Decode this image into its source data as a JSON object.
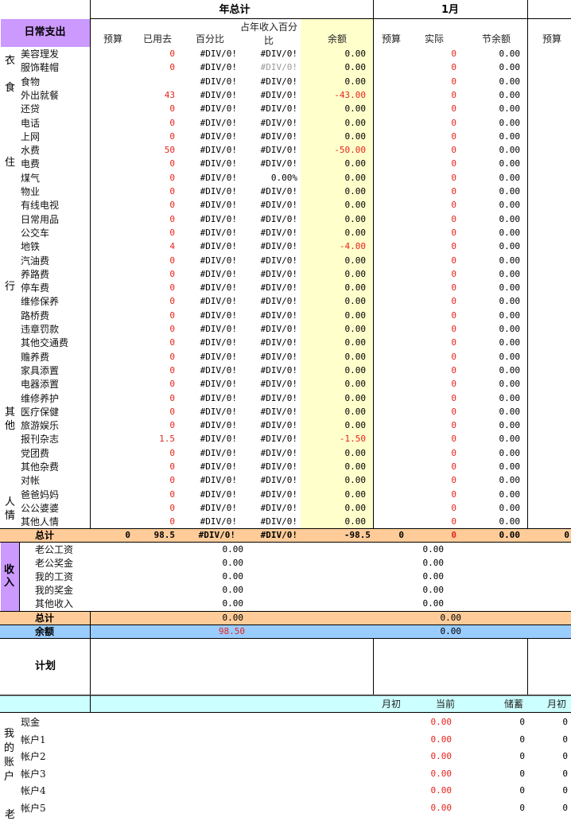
{
  "colors": {
    "header_purple": "#cc99ff",
    "yellow_col": "#ffffcc",
    "total_orange": "#ffcc99",
    "balance_blue": "#99ccff",
    "cyan_row": "#ccffff",
    "red_text": "#e8231b"
  },
  "top": {
    "year_total": "年总计",
    "month": "1月"
  },
  "daily": {
    "title": "日常支出",
    "headers": {
      "budget": "预算",
      "used": "已用去",
      "percent": "百分比",
      "income_pct": "占年收入百分比",
      "balance": "余额",
      "m_budget": "预算",
      "m_actual": "实际",
      "m_saved": "节余额",
      "n_budget": "预算"
    },
    "categories": [
      "衣",
      "食",
      "住",
      "行",
      "其他",
      "人情"
    ],
    "rows": [
      {
        "name": "美容理发",
        "used": "0",
        "pct": "#DIV/0!",
        "inc": "#DIV/0!",
        "bal": "0.00",
        "act": "0",
        "save": "0.00"
      },
      {
        "name": "服饰鞋帽",
        "used": "0",
        "pct": "#DIV/0!",
        "inc": "#DIV/0!",
        "bal": "0.00",
        "act": "0",
        "save": "0.00"
      },
      {
        "name": "食物",
        "used": "",
        "pct": "#DIV/0!",
        "inc": "#DIV/0!",
        "bal": "0.00",
        "act": "0",
        "save": "0.00"
      },
      {
        "name": "外出就餐",
        "used": "43",
        "pct": "#DIV/0!",
        "inc": "#DIV/0!",
        "bal": "-43.00",
        "act": "0",
        "save": "0.00"
      },
      {
        "name": "还贷",
        "used": "0",
        "pct": "#DIV/0!",
        "inc": "#DIV/0!",
        "bal": "0.00",
        "act": "0",
        "save": "0.00"
      },
      {
        "name": "电话",
        "used": "0",
        "pct": "#DIV/0!",
        "inc": "#DIV/0!",
        "bal": "0.00",
        "act": "0",
        "save": "0.00"
      },
      {
        "name": "上网",
        "used": "0",
        "pct": "#DIV/0!",
        "inc": "#DIV/0!",
        "bal": "0.00",
        "act": "0",
        "save": "0.00"
      },
      {
        "name": "水费",
        "used": "50",
        "pct": "#DIV/0!",
        "inc": "#DIV/0!",
        "bal": "-50.00",
        "act": "0",
        "save": "0.00"
      },
      {
        "name": "电费",
        "used": "0",
        "pct": "#DIV/0!",
        "inc": "#DIV/0!",
        "bal": "0.00",
        "act": "0",
        "save": "0.00"
      },
      {
        "name": "煤气",
        "used": "0",
        "pct": "#DIV/0!",
        "inc": "0.00%",
        "bal": "0.00",
        "act": "0",
        "save": "0.00"
      },
      {
        "name": "物业",
        "used": "0",
        "pct": "#DIV/0!",
        "inc": "#DIV/0!",
        "bal": "0.00",
        "act": "0",
        "save": "0.00"
      },
      {
        "name": "有线电视",
        "used": "0",
        "pct": "#DIV/0!",
        "inc": "#DIV/0!",
        "bal": "0.00",
        "act": "0",
        "save": "0.00"
      },
      {
        "name": "日常用品",
        "used": "0",
        "pct": "#DIV/0!",
        "inc": "#DIV/0!",
        "bal": "0.00",
        "act": "0",
        "save": "0.00"
      },
      {
        "name": "公交车",
        "used": "0",
        "pct": "#DIV/0!",
        "inc": "#DIV/0!",
        "bal": "0.00",
        "act": "0",
        "save": "0.00"
      },
      {
        "name": "地铁",
        "used": "4",
        "pct": "#DIV/0!",
        "inc": "#DIV/0!",
        "bal": "-4.00",
        "act": "0",
        "save": "0.00"
      },
      {
        "name": "汽油费",
        "used": "0",
        "pct": "#DIV/0!",
        "inc": "#DIV/0!",
        "bal": "0.00",
        "act": "0",
        "save": "0.00"
      },
      {
        "name": "养路费",
        "used": "0",
        "pct": "#DIV/0!",
        "inc": "#DIV/0!",
        "bal": "0.00",
        "act": "0",
        "save": "0.00"
      },
      {
        "name": "停车费",
        "used": "0",
        "pct": "#DIV/0!",
        "inc": "#DIV/0!",
        "bal": "0.00",
        "act": "0",
        "save": "0.00"
      },
      {
        "name": "维修保养",
        "used": "0",
        "pct": "#DIV/0!",
        "inc": "#DIV/0!",
        "bal": "0.00",
        "act": "0",
        "save": "0.00"
      },
      {
        "name": "路桥费",
        "used": "0",
        "pct": "#DIV/0!",
        "inc": "#DIV/0!",
        "bal": "0.00",
        "act": "0",
        "save": "0.00"
      },
      {
        "name": "违章罚款",
        "used": "0",
        "pct": "#DIV/0!",
        "inc": "#DIV/0!",
        "bal": "0.00",
        "act": "0",
        "save": "0.00"
      },
      {
        "name": "其他交通费",
        "used": "0",
        "pct": "#DIV/0!",
        "inc": "#DIV/0!",
        "bal": "0.00",
        "act": "0",
        "save": "0.00"
      },
      {
        "name": "赡养费",
        "used": "0",
        "pct": "#DIV/0!",
        "inc": "#DIV/0!",
        "bal": "0.00",
        "act": "0",
        "save": "0.00"
      },
      {
        "name": "家具添置",
        "used": "0",
        "pct": "#DIV/0!",
        "inc": "#DIV/0!",
        "bal": "0.00",
        "act": "0",
        "save": "0.00"
      },
      {
        "name": "电器添置",
        "used": "0",
        "pct": "#DIV/0!",
        "inc": "#DIV/0!",
        "bal": "0.00",
        "act": "0",
        "save": "0.00"
      },
      {
        "name": "维修养护",
        "used": "0",
        "pct": "#DIV/0!",
        "inc": "#DIV/0!",
        "bal": "0.00",
        "act": "0",
        "save": "0.00"
      },
      {
        "name": "医疗保健",
        "used": "0",
        "pct": "#DIV/0!",
        "inc": "#DIV/0!",
        "bal": "0.00",
        "act": "0",
        "save": "0.00"
      },
      {
        "name": "旅游娱乐",
        "used": "0",
        "pct": "#DIV/0!",
        "inc": "#DIV/0!",
        "bal": "0.00",
        "act": "0",
        "save": "0.00"
      },
      {
        "name": "报刊杂志",
        "used": "1.5",
        "pct": "#DIV/0!",
        "inc": "#DIV/0!",
        "bal": "-1.50",
        "act": "0",
        "save": "0.00"
      },
      {
        "name": "党团费",
        "used": "0",
        "pct": "#DIV/0!",
        "inc": "#DIV/0!",
        "bal": "0.00",
        "act": "0",
        "save": "0.00"
      },
      {
        "name": "其他杂费",
        "used": "0",
        "pct": "#DIV/0!",
        "inc": "#DIV/0!",
        "bal": "0.00",
        "act": "0",
        "save": "0.00"
      },
      {
        "name": "对帐",
        "used": "0",
        "pct": "#DIV/0!",
        "inc": "#DIV/0!",
        "bal": "0.00",
        "act": "0",
        "save": "0.00"
      },
      {
        "name": "爸爸妈妈",
        "used": "0",
        "pct": "#DIV/0!",
        "inc": "#DIV/0!",
        "bal": "0.00",
        "act": "0",
        "save": "0.00"
      },
      {
        "name": "公公婆婆",
        "used": "0",
        "pct": "#DIV/0!",
        "inc": "#DIV/0!",
        "bal": "0.00",
        "act": "0",
        "save": "0.00"
      },
      {
        "name": "其他人情",
        "used": "0",
        "pct": "#DIV/0!",
        "inc": "#DIV/0!",
        "bal": "0.00",
        "act": "0",
        "save": "0.00"
      }
    ],
    "total": {
      "label": "总计",
      "budget": "0",
      "used": "98.5",
      "pct": "#DIV/0!",
      "inc": "#DIV/0!",
      "bal": "-98.5",
      "m_budget": "0",
      "m_actual": "0",
      "m_saved": "0.00",
      "n_budget": "0"
    }
  },
  "income": {
    "title": "收入",
    "rows": [
      {
        "name": "老公工资",
        "year": "0.00",
        "month": "0.00"
      },
      {
        "name": "老公奖金",
        "year": "0.00",
        "month": "0.00"
      },
      {
        "name": "我的工资",
        "year": "0.00",
        "month": "0.00"
      },
      {
        "name": "我的奖金",
        "year": "0.00",
        "month": "0.00"
      },
      {
        "name": "其他收入",
        "year": "0.00",
        "month": "0.00"
      }
    ],
    "total": {
      "label": "总计",
      "year": "0.00",
      "month": "0.00"
    },
    "balance": {
      "label": "余额",
      "year": "98.50",
      "month": "0.00"
    }
  },
  "plan": {
    "label": "计划"
  },
  "accounts": {
    "title": "我的账户",
    "headers": {
      "start": "月初",
      "current": "当前",
      "saving": "储蓄",
      "next_start": "月初"
    },
    "rows": [
      {
        "name": "现金",
        "current": "0.00",
        "saving": "0",
        "next": "0"
      },
      {
        "name": "帐户1",
        "current": "0.00",
        "saving": "0",
        "next": "0"
      },
      {
        "name": "帐户2",
        "current": "0.00",
        "saving": "0",
        "next": "0"
      },
      {
        "name": "帐户3",
        "current": "0.00",
        "saving": "0",
        "next": "0"
      },
      {
        "name": "帐户4",
        "current": "0.00",
        "saving": "0",
        "next": "0"
      },
      {
        "name": "帐户5",
        "current": "0.00",
        "saving": "0",
        "next": "0"
      }
    ],
    "cut_char": "老"
  }
}
